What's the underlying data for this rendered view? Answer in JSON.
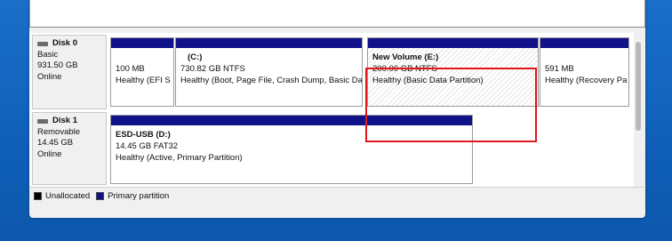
{
  "disks": [
    {
      "title": "Disk 0",
      "type": "Basic",
      "size": "931.50 GB",
      "status": "Online",
      "partitions": [
        {
          "name": "",
          "size": "100 MB",
          "status": "Healthy (EFI S"
        },
        {
          "name": "(C:)",
          "size": "730.82 GB NTFS",
          "status": "Healthy (Boot, Page File, Crash Dump, Basic Da"
        },
        {
          "name": "New Volume  (E:)",
          "size": "200.00 GB NTFS",
          "status": "Healthy (Basic Data Partition)"
        },
        {
          "name": "",
          "size": "591 MB",
          "status": "Healthy (Recovery Pa"
        }
      ]
    },
    {
      "title": "Disk 1",
      "type": "Removable",
      "size": "14.45 GB",
      "status": "Online",
      "partitions": [
        {
          "name": "ESD-USB  (D:)",
          "size": "14.45 GB FAT32",
          "status": "Healthy (Active, Primary Partition)"
        }
      ]
    }
  ],
  "legend": {
    "unallocated": "Unallocated",
    "primary": "Primary partition"
  },
  "colors": {
    "primary_partition": "#10128a",
    "unallocated": "#000000",
    "highlight": "#e2151b"
  }
}
